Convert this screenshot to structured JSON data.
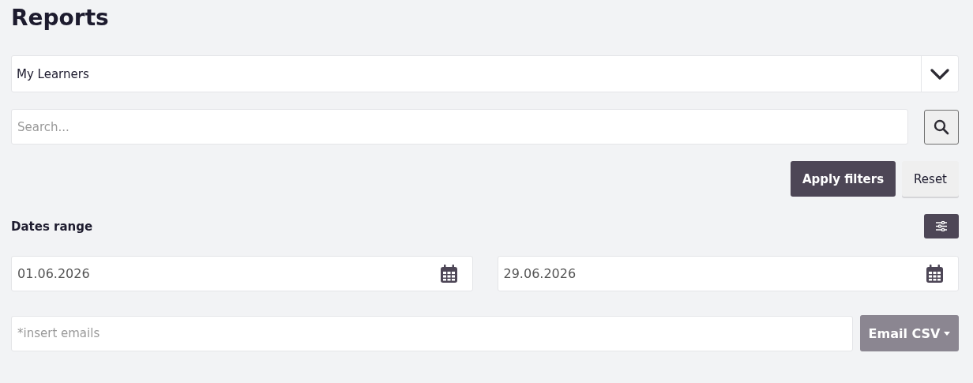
{
  "title": "Reports",
  "report_select": {
    "value": "My Learners"
  },
  "search": {
    "placeholder": "Search..."
  },
  "buttons": [
    {
      "label": "Apply filters",
      "kind": "primary"
    },
    {
      "label": "Reset",
      "kind": "secondary"
    }
  ],
  "dates_range": {
    "label": "Dates range",
    "from": "01.06.2026",
    "to": "29.06.2026"
  },
  "emails": {
    "placeholder": "*insert emails"
  },
  "email_csv": {
    "label": "Email CSV",
    "disabled": true
  }
}
